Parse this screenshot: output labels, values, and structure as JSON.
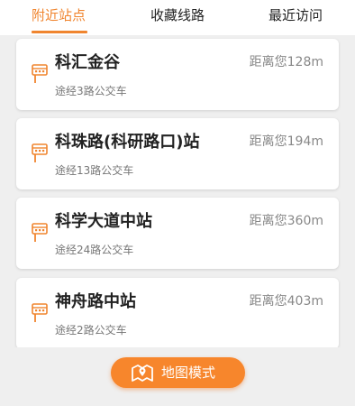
{
  "tabs": [
    {
      "label": "附近站点",
      "active": true
    },
    {
      "label": "收藏线路",
      "active": false
    },
    {
      "label": "最近访问",
      "active": false
    }
  ],
  "stations": [
    {
      "name": "科汇金谷",
      "routes": "途经3路公交车",
      "distance": "距离您128m"
    },
    {
      "name": "科珠路(科研路口)站",
      "routes": "途经13路公交车",
      "distance": "距离您194m"
    },
    {
      "name": "科学大道中站",
      "routes": "途经24路公交车",
      "distance": "距离您360m"
    },
    {
      "name": "神舟路中站",
      "routes": "途经2路公交车",
      "distance": "距离您403m"
    }
  ],
  "map_button": {
    "label": "地图模式",
    "icon": "map-pin-icon"
  },
  "stop_icon": "bus-stop-icon",
  "colors": {
    "accent": "#f0852f",
    "button": "#f7862c",
    "background": "#efefef"
  }
}
